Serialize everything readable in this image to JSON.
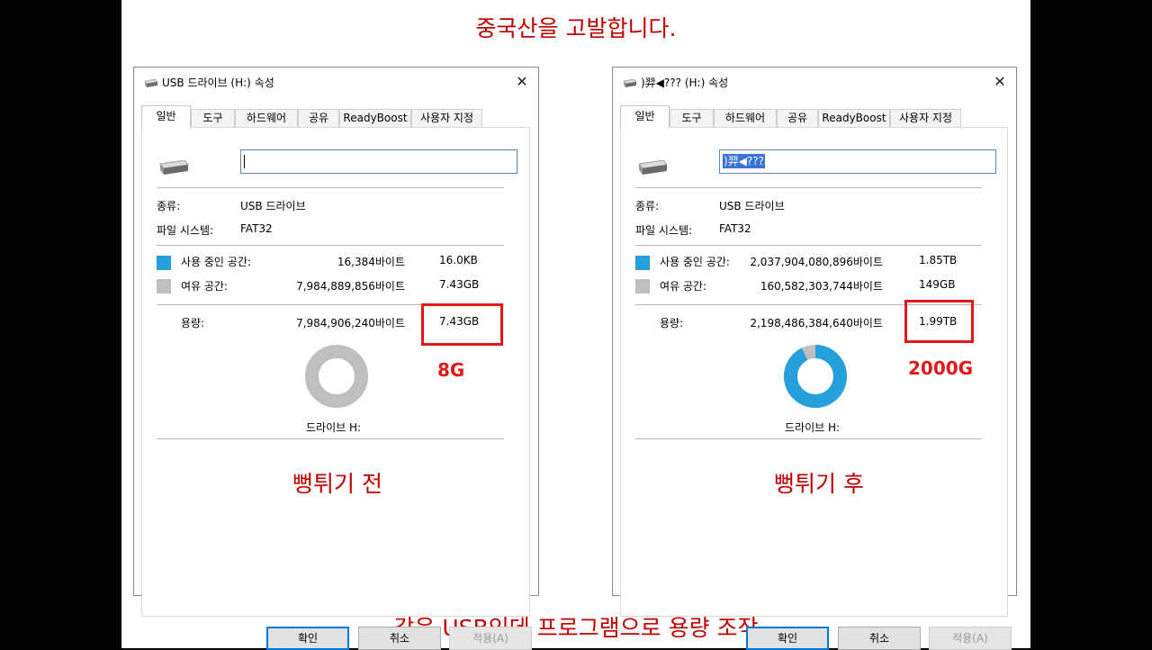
{
  "slide": {
    "top_caption": "중국산을 고발합니다.",
    "bottom_caption": "같은 USB인데 프로그램으로 용량 조작"
  },
  "tabs": [
    "일반",
    "도구",
    "하드웨어",
    "공유",
    "ReadyBoost",
    "사용자 지정"
  ],
  "labels": {
    "type": "종류:",
    "filesystem": "파일 시스템:",
    "used": "사용 중인 공간:",
    "free": "여유 공간:",
    "capacity": "용량:"
  },
  "buttons": {
    "ok": "확인",
    "cancel": "취소",
    "apply": "적용(A)"
  },
  "colors": {
    "used": "#26a0da",
    "free": "#bfbfbf",
    "highlight": "#e01818",
    "caption": "#c00000"
  },
  "icons": {
    "drive": "usb-drive-icon",
    "close": "close-icon"
  },
  "before": {
    "title": "USB 드라이브 (H:) 속성",
    "name_value": "",
    "type_value": "USB 드라이브",
    "filesystem_value": "FAT32",
    "used_bytes": "16,384바이트",
    "used_size": "16.0KB",
    "free_bytes": "7,984,889,856바이트",
    "free_size": "7.43GB",
    "capacity_bytes": "7,984,906,240바이트",
    "capacity_size": "7.43GB",
    "drive_label": "드라이브 H:",
    "annotation": "8G",
    "stage_label": "뻥튀기 전",
    "used_fraction": 2e-06
  },
  "after": {
    "title": ")羿◀??? (H:) 속성",
    "name_value": ")羿◀???",
    "type_value": "USB 드라이브",
    "filesystem_value": "FAT32",
    "used_bytes": "2,037,904,080,896바이트",
    "used_size": "1.85TB",
    "free_bytes": "160,582,303,744바이트",
    "free_size": "149GB",
    "capacity_bytes": "2,198,486,384,640바이트",
    "capacity_size": "1.99TB",
    "drive_label": "드라이브 H:",
    "annotation": "2000G",
    "stage_label": "뻥튀기 후",
    "used_fraction": 0.927
  }
}
